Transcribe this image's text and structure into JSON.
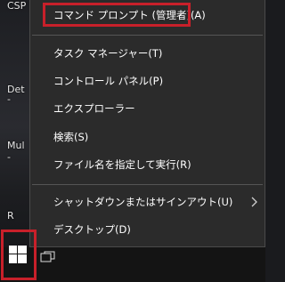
{
  "desktop": {
    "labels": [
      "CSP",
      "Det",
      "-",
      "Mul",
      "-",
      "R"
    ]
  },
  "menu": {
    "items": [
      {
        "label": "コマンド プロンプト (管理者)(A)"
      },
      {
        "label": "タスク マネージャー(T)"
      },
      {
        "label": "コントロール パネル(P)"
      },
      {
        "label": "エクスプローラー"
      },
      {
        "label": "検索(S)"
      },
      {
        "label": "ファイル名を指定して実行(R)"
      },
      {
        "label": "シャットダウンまたはサインアウト(U)",
        "submenu": true
      },
      {
        "label": "デスクトップ(D)"
      }
    ]
  },
  "taskbar": {
    "start_icon": "windows-logo-icon",
    "task_view_icon": "task-view-icon"
  },
  "colors": {
    "menu_bg": "#2b2b2b",
    "highlight": "#c8202a",
    "text": "#ffffff"
  }
}
